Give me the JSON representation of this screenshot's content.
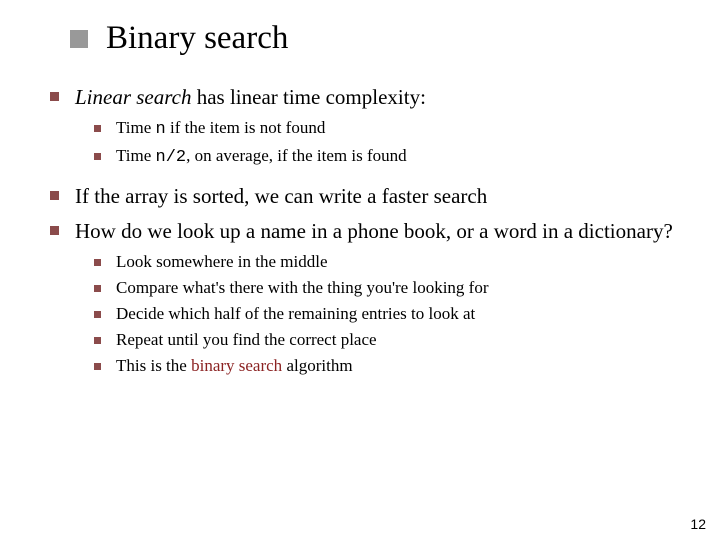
{
  "title": "Binary search",
  "page_number": "12",
  "bullets": {
    "b1": {
      "italic": "Linear search",
      "rest": " has linear time complexity:",
      "sub": {
        "s1_a": "Time ",
        "s1_code": "n",
        "s1_b": " if the item is not found",
        "s2_a": "Time ",
        "s2_code": "n/2",
        "s2_b": ", on average, if the item is found"
      }
    },
    "b2": "If the array is sorted, we can write a faster search",
    "b3": {
      "text": "How do we look up a name in a phone book, or a word in a dictionary?",
      "sub": {
        "s1": "Look somewhere in the middle",
        "s2": "Compare what's there with the thing you're looking for",
        "s3": "Decide which half of the remaining entries to look at",
        "s4": "Repeat until you find the correct place",
        "s5_a": "This is the ",
        "s5_maroon": "binary search",
        "s5_b": " algorithm"
      }
    }
  }
}
